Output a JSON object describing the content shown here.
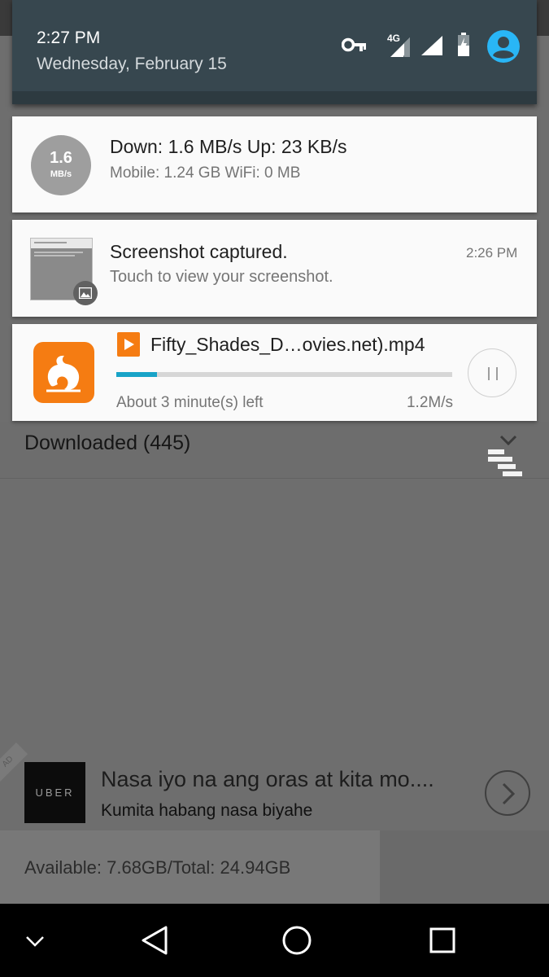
{
  "status": {
    "time": "2:27 PM",
    "date": "Wednesday, February 15",
    "network_label": "4G",
    "icons": [
      "vpn-key-icon",
      "signal-4g-icon",
      "wifi-signal-icon",
      "battery-charging-icon",
      "account-icon"
    ],
    "colors": {
      "shade": "#37474f",
      "account": "#29b6f6"
    }
  },
  "notifications": {
    "speed": {
      "value": "1.6",
      "unit": "MB/s",
      "line1": "Down: 1.6 MB/s   Up: 23 KB/s",
      "line2": "Mobile: 1.24 GB   WiFi: 0 MB"
    },
    "screenshot": {
      "title": "Screenshot captured.",
      "subtitle": "Touch to view your screenshot.",
      "time": "2:26 PM",
      "icon": "image-icon"
    },
    "download": {
      "app_icon": "uc-browser-icon",
      "file_icon": "video-file-icon",
      "filename": "Fifty_Shades_D…ovies.net).mp4",
      "progress": 0.12,
      "time_left": "About 3 minute(s) left",
      "speed": "1.2M/s",
      "progress_color": "#18a3c7",
      "action_icon": "pause-icon"
    }
  },
  "app": {
    "downloaded_label": "Downloaded (445)",
    "ad": {
      "badge": "AD",
      "logo": "UBER",
      "title": "Nasa iyo na ang oras at kita mo....",
      "subtitle": "Kumita habang nasa biyahe"
    },
    "storage": "Available: 7.68GB/Total: 24.94GB"
  },
  "navbar": {
    "icons": [
      "hide-keyboard-icon",
      "back-icon",
      "home-icon",
      "recents-icon"
    ]
  }
}
